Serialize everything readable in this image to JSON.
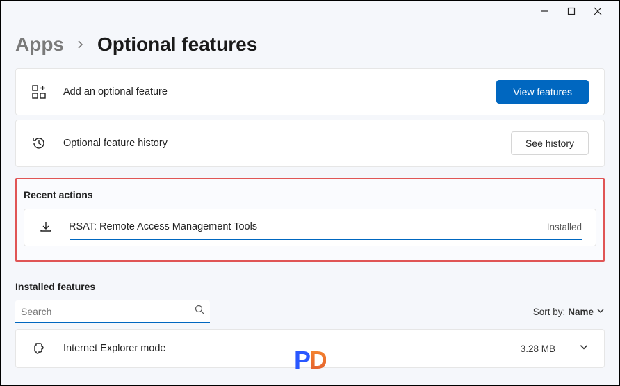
{
  "titlebar": {
    "minimize": "–",
    "maximize": "□",
    "close": "×"
  },
  "breadcrumb": {
    "parent": "Apps",
    "current": "Optional features"
  },
  "cards": {
    "add": {
      "label": "Add an optional feature",
      "button": "View features"
    },
    "history": {
      "label": "Optional feature history",
      "button": "See history"
    }
  },
  "recent": {
    "title": "Recent actions",
    "item": {
      "label": "RSAT: Remote Access Management Tools",
      "status": "Installed"
    }
  },
  "installed": {
    "title": "Installed features",
    "search_placeholder": "Search",
    "sort_label": "Sort by:",
    "sort_value": "Name",
    "feature": {
      "label": "Internet Explorer mode",
      "size": "3.28 MB"
    }
  }
}
